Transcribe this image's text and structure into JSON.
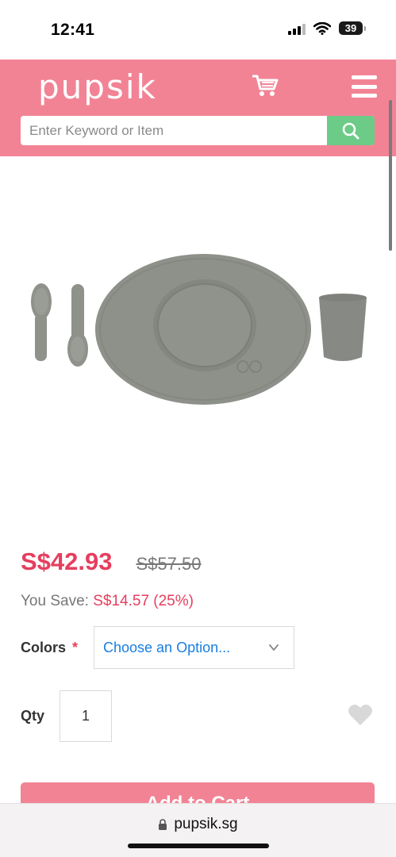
{
  "status_bar": {
    "time": "12:41",
    "battery": "39",
    "icons": [
      "signal-icon",
      "wifi-icon",
      "battery-icon"
    ]
  },
  "header": {
    "logo": "pupsik",
    "cart_icon": "cart-icon",
    "menu_icon": "menu-icon",
    "brand_color": "#f28395"
  },
  "search": {
    "placeholder": "Enter Keyword or Item",
    "button_icon": "search-icon",
    "button_color": "#6ccb86"
  },
  "product": {
    "image_description_icon": "product-image",
    "price": "S$42.93",
    "old_price": "S$57.50",
    "savings_label": "You Save:",
    "savings_amount": "S$14.57 (25%)",
    "accent_color": "#e63e5e"
  },
  "options": {
    "colors_label": "Colors",
    "required_mark": "*",
    "colors_selected": "Choose an Option...",
    "qty_label": "Qty",
    "qty_value": "1"
  },
  "actions": {
    "add_to_cart": "Add to Cart",
    "wishlist_icon": "heart-icon"
  },
  "browser": {
    "url": "pupsik.sg",
    "lock_icon": "lock-icon"
  }
}
